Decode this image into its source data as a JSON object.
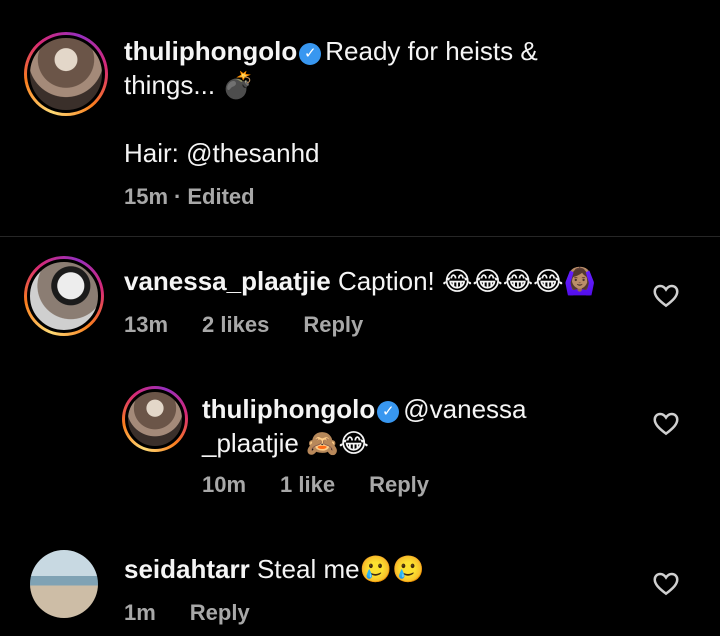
{
  "caption": {
    "username": "thuliphongolo",
    "verified_icon": "verified-badge-icon",
    "line1": "Ready for heists &",
    "line2": "things... 💣",
    "line3": "Hair: @thesanhd",
    "time": "15m",
    "separator": "·",
    "edited": "Edited"
  },
  "comments": [
    {
      "username": "vanessa_plaatjie",
      "text": "Caption! 😂😂😂😂🙆🏽‍♀️",
      "time": "13m",
      "likes": "2 likes",
      "reply": "Reply"
    },
    {
      "username": "thuliphongolo",
      "text_line1": "@vanessa",
      "text_line2": "_plaatjie 🙈😂",
      "time": "10m",
      "likes": "1 like",
      "reply": "Reply"
    },
    {
      "username": "seidahtarr",
      "text": "Steal me🥲🥲",
      "time": "1m",
      "reply": "Reply"
    }
  ],
  "colors": {
    "background": "#000000",
    "text": "#f5f5f5",
    "meta": "#a8a8a8",
    "verified": "#3897f0"
  }
}
